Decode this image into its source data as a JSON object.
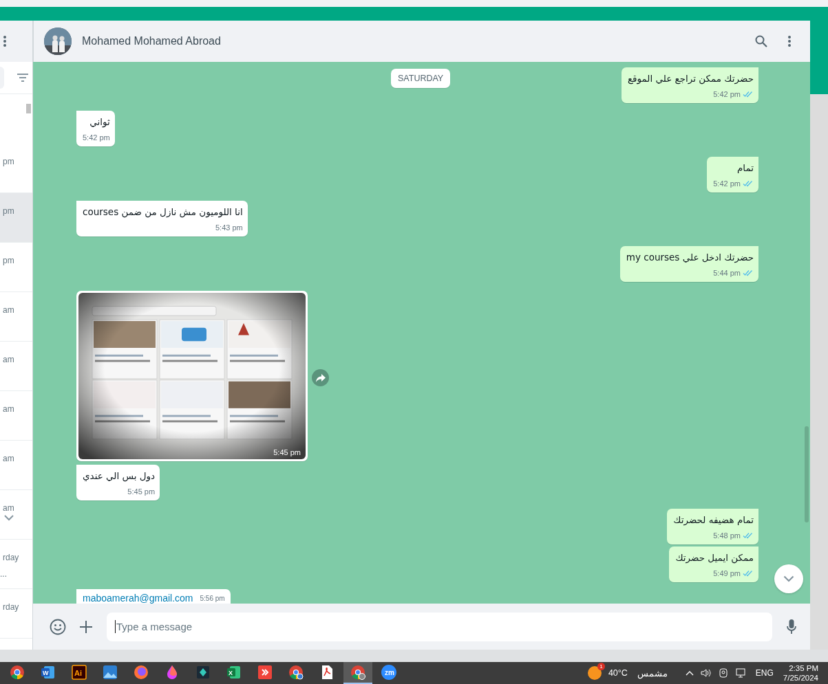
{
  "sidebar": {
    "chats": [
      {
        "time": "pm",
        "selected": false,
        "hovered": false
      },
      {
        "time": "pm",
        "selected": true,
        "hovered": false
      },
      {
        "time": "pm",
        "selected": false,
        "hovered": false
      },
      {
        "time": "am",
        "selected": false,
        "hovered": false
      },
      {
        "time": "am",
        "selected": false,
        "hovered": false
      },
      {
        "time": "am",
        "selected": false,
        "hovered": false
      },
      {
        "time": "am",
        "selected": false,
        "hovered": false
      },
      {
        "time": "am",
        "selected": false,
        "hovered": true
      },
      {
        "time": "rday",
        "preview": "...",
        "selected": false,
        "hovered": false
      },
      {
        "time": "rday",
        "selected": false,
        "hovered": false
      }
    ]
  },
  "chat": {
    "contact": {
      "name": "Mohamed Mohamed Abroad"
    },
    "date_chip": "SATURDAY",
    "messages": [
      {
        "outgoing": true,
        "kind": "text",
        "text": "حضرتك ممكن تراجع علي الموقع",
        "time": "5:42 pm",
        "read": true
      },
      {
        "outgoing": false,
        "kind": "text",
        "text": "ثواني",
        "time": "5:42 pm"
      },
      {
        "outgoing": true,
        "kind": "text",
        "text": "تمام",
        "time": "5:42 pm",
        "read": true
      },
      {
        "outgoing": false,
        "kind": "text",
        "text": "انا اللوميون مش نازل من ضمن courses",
        "time": "5:43 pm"
      },
      {
        "outgoing": true,
        "kind": "text",
        "text": "حضرتك ادخل علي my courses",
        "time": "5:44 pm",
        "read": true
      },
      {
        "outgoing": false,
        "time": "5:45 pm"
      },
      {
        "outgoing": false,
        "kind": "text",
        "text": "دول بس الي عندي",
        "time": "5:45 pm"
      },
      {
        "outgoing": true,
        "kind": "text",
        "text": "تمام هضيفه لحضرتك",
        "time": "5:48 pm",
        "read": true
      },
      {
        "outgoing": true,
        "kind": "text",
        "text": "ممكن ايميل حضرتك",
        "time": "5:49 pm",
        "read": true
      },
      {
        "outgoing": false,
        "kind": "link",
        "text": "maboamerah@gmail.com",
        "time": "5:56 pm"
      }
    ],
    "composer": {
      "placeholder": "Type a message"
    }
  },
  "taskbar": {
    "apps": [
      {
        "selected": false
      },
      {
        "selected": false,
        "label": "W"
      },
      {
        "selected": false,
        "label": "Ai"
      },
      {
        "selected": false
      },
      {
        "selected": false
      },
      {
        "selected": false
      },
      {
        "selected": false
      },
      {
        "selected": false,
        "label": "X"
      },
      {
        "selected": false
      },
      {
        "selected": false
      },
      {
        "selected": false
      },
      {
        "selected": true
      },
      {
        "selected": false,
        "label": "zm"
      }
    ],
    "weather": {
      "badge": "1",
      "temperature": "40°C",
      "condition": "مشمس"
    },
    "language": "ENG",
    "time": "2:35 PM",
    "date": "7/25/2024"
  }
}
